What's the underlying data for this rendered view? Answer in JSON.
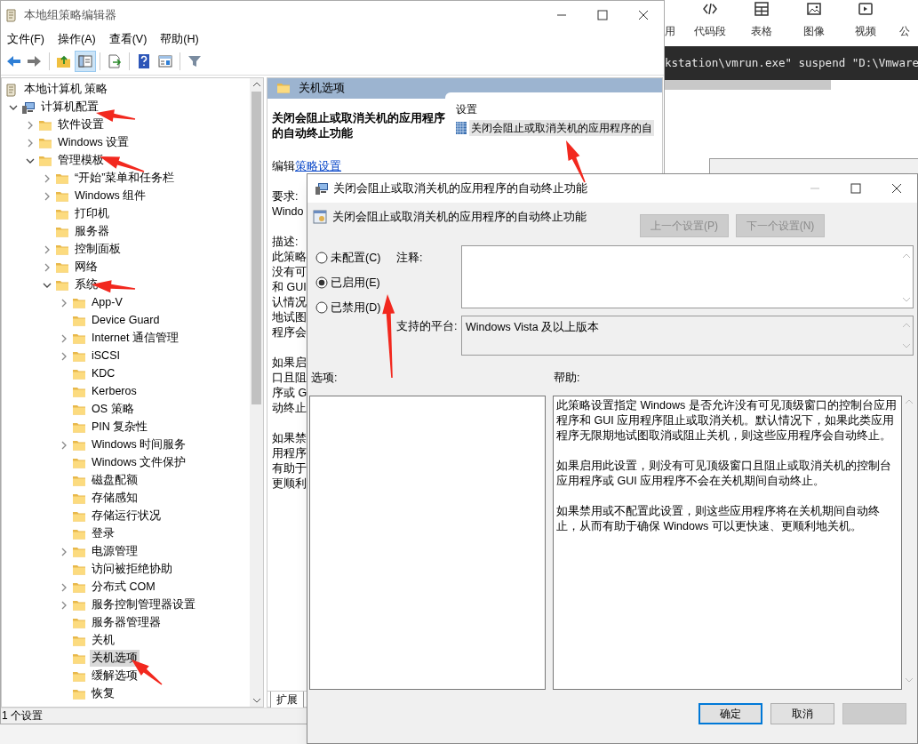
{
  "main_window": {
    "title": "本地组策略编辑器",
    "menu": [
      "文件(F)",
      "操作(A)",
      "查看(V)",
      "帮助(H)"
    ],
    "toolbar": [
      [
        {
          "kind": "back",
          "selected": false
        },
        {
          "kind": "forward",
          "selected": false
        }
      ],
      [
        {
          "kind": "up",
          "selected": false
        },
        {
          "kind": "tree",
          "selected": true
        }
      ],
      [
        {
          "kind": "export",
          "selected": false
        }
      ],
      [
        {
          "kind": "help",
          "selected": false
        },
        {
          "kind": "view",
          "selected": false
        }
      ],
      [
        {
          "kind": "filter",
          "selected": false
        }
      ]
    ],
    "tree": [
      {
        "label": "本地计算机 策略",
        "kind": "policy",
        "selected": false,
        "children": [
          {
            "label": "计算机配置",
            "kind": "computer",
            "expandable": true,
            "expanded": true,
            "selected": false,
            "children": [
              {
                "label": "软件设置",
                "kind": "folder",
                "expandable": true,
                "expanded": false,
                "selected": false
              },
              {
                "label": "Windows 设置",
                "kind": "folder",
                "expandable": true,
                "expanded": false,
                "selected": false
              },
              {
                "label": "管理模板",
                "kind": "folder",
                "expandable": true,
                "expanded": true,
                "selected": false,
                "children": [
                  {
                    "label": "“开始”菜单和任务栏",
                    "kind": "folder",
                    "expandable": true,
                    "expanded": false,
                    "selected": false
                  },
                  {
                    "label": "Windows 组件",
                    "kind": "folder",
                    "expandable": true,
                    "expanded": false,
                    "selected": false
                  },
                  {
                    "label": "打印机",
                    "kind": "folder",
                    "expandable": false,
                    "selected": false
                  },
                  {
                    "label": "服务器",
                    "kind": "folder",
                    "expandable": false,
                    "selected": false
                  },
                  {
                    "label": "控制面板",
                    "kind": "folder",
                    "expandable": true,
                    "expanded": false,
                    "selected": false
                  },
                  {
                    "label": "网络",
                    "kind": "folder",
                    "expandable": true,
                    "expanded": false,
                    "selected": false
                  },
                  {
                    "label": "系统",
                    "kind": "folder",
                    "expandable": true,
                    "expanded": true,
                    "selected": false,
                    "children": [
                      {
                        "label": "App-V",
                        "kind": "folder",
                        "expandable": true,
                        "expanded": false,
                        "selected": false
                      },
                      {
                        "label": "Device Guard",
                        "kind": "folder",
                        "expandable": false,
                        "selected": false
                      },
                      {
                        "label": "Internet 通信管理",
                        "kind": "folder",
                        "expandable": true,
                        "expanded": false,
                        "selected": false
                      },
                      {
                        "label": "iSCSI",
                        "kind": "folder",
                        "expandable": true,
                        "expanded": false,
                        "selected": false
                      },
                      {
                        "label": "KDC",
                        "kind": "folder",
                        "expandable": false,
                        "selected": false
                      },
                      {
                        "label": "Kerberos",
                        "kind": "folder",
                        "expandable": false,
                        "selected": false
                      },
                      {
                        "label": "OS 策略",
                        "kind": "folder",
                        "expandable": false,
                        "selected": false
                      },
                      {
                        "label": "PIN 复杂性",
                        "kind": "folder",
                        "expandable": false,
                        "selected": false
                      },
                      {
                        "label": "Windows 时间服务",
                        "kind": "folder",
                        "expandable": true,
                        "expanded": false,
                        "selected": false
                      },
                      {
                        "label": "Windows 文件保护",
                        "kind": "folder",
                        "expandable": false,
                        "selected": false
                      },
                      {
                        "label": "磁盘配额",
                        "kind": "folder",
                        "expandable": false,
                        "selected": false
                      },
                      {
                        "label": "存储感知",
                        "kind": "folder",
                        "expandable": false,
                        "selected": false
                      },
                      {
                        "label": "存储运行状况",
                        "kind": "folder",
                        "expandable": false,
                        "selected": false
                      },
                      {
                        "label": "登录",
                        "kind": "folder",
                        "expandable": false,
                        "selected": false
                      },
                      {
                        "label": "电源管理",
                        "kind": "folder",
                        "expandable": true,
                        "expanded": false,
                        "selected": false
                      },
                      {
                        "label": "访问被拒绝协助",
                        "kind": "folder",
                        "expandable": false,
                        "selected": false
                      },
                      {
                        "label": "分布式 COM",
                        "kind": "folder",
                        "expandable": true,
                        "expanded": false,
                        "selected": false
                      },
                      {
                        "label": "服务控制管理器设置",
                        "kind": "folder",
                        "expandable": true,
                        "expanded": false,
                        "selected": false
                      },
                      {
                        "label": "服务器管理器",
                        "kind": "folder",
                        "expandable": false,
                        "selected": false
                      },
                      {
                        "label": "关机",
                        "kind": "folder",
                        "expandable": false,
                        "selected": false
                      },
                      {
                        "label": "关机选项",
                        "kind": "folder",
                        "expandable": false,
                        "selected": true
                      },
                      {
                        "label": "缓解选项",
                        "kind": "folder",
                        "expandable": false,
                        "selected": false
                      },
                      {
                        "label": "恢复",
                        "kind": "folder",
                        "expandable": false,
                        "selected": false
                      }
                    ]
                  }
                ]
              }
            ]
          }
        ]
      }
    ],
    "detail_pane": {
      "header": "关机选项",
      "title": "关闭会阻止或取消关机的应用程序的自动终止功能",
      "edit_prefix": "编辑",
      "edit_link": "策略设置",
      "requirement_label": "要求:",
      "requirement": "Windo",
      "description_label": "描述:",
      "description": [
        [
          "此策略",
          "没有可",
          "和 GUI",
          "认情况",
          "地试图",
          "程序会"
        ],
        [
          "如果启",
          "口且阻",
          "序或 G",
          "动终止"
        ],
        [
          "如果禁",
          "用程序",
          "有助于",
          "更顺利"
        ]
      ]
    },
    "settings_list": {
      "column": "设置",
      "items": [
        {
          "label": "关闭会阻止或取消关机的应用程序的自",
          "selected": true
        }
      ]
    },
    "tabs": [
      {
        "label": "扩展",
        "selected": true
      }
    ],
    "status_bar": "1 个设置"
  },
  "background_app": {
    "toolbar": [
      {
        "kind": "partial",
        "label": "用"
      },
      {
        "kind": "code",
        "label": "代码段"
      },
      {
        "kind": "table",
        "label": "表格"
      },
      {
        "kind": "image",
        "label": "图像"
      },
      {
        "kind": "video",
        "label": "视频"
      },
      {
        "kind": "partial",
        "label": "公"
      }
    ],
    "console_line": "kstation\\vmrun.exe\" suspend \"D:\\Vmware"
  },
  "dialog": {
    "title": "关闭会阻止或取消关机的应用程序的自动终止功能",
    "heading": "关闭会阻止或取消关机的应用程序的自动终止功能",
    "nav_buttons": [
      {
        "label": "上一个设置(P)",
        "disabled": true
      },
      {
        "label": "下一个设置(N)",
        "disabled": true
      }
    ],
    "states": [
      {
        "label": "未配置(C)",
        "selected": false
      },
      {
        "label": "已启用(E)",
        "selected": true
      },
      {
        "label": "已禁用(D)",
        "selected": false
      }
    ],
    "comment_label": "注释:",
    "platform_label": "支持的平台:",
    "platform": "Windows Vista 及以上版本",
    "options_label": "选项:",
    "help_label": "帮助:",
    "help": [
      "此策略设置指定 Windows 是否允许没有可见顶级窗口的控制台应用程序和 GUI 应用程序阻止或取消关机。默认情况下，如果此类应用程序无限期地试图取消或阻止关机，则这些应用程序会自动终止。",
      "如果启用此设置，则没有可见顶级窗口且阻止或取消关机的控制台应用程序或 GUI 应用程序不会在关机期间自动终止。",
      "如果禁用或不配置此设置，则这些应用程序将在关机期间自动终止，从而有助于确保 Windows 可以更快速、更顺利地关机。"
    ],
    "buttons": [
      {
        "label": "确定",
        "default": true
      },
      {
        "label": "取消",
        "default": false
      }
    ]
  }
}
